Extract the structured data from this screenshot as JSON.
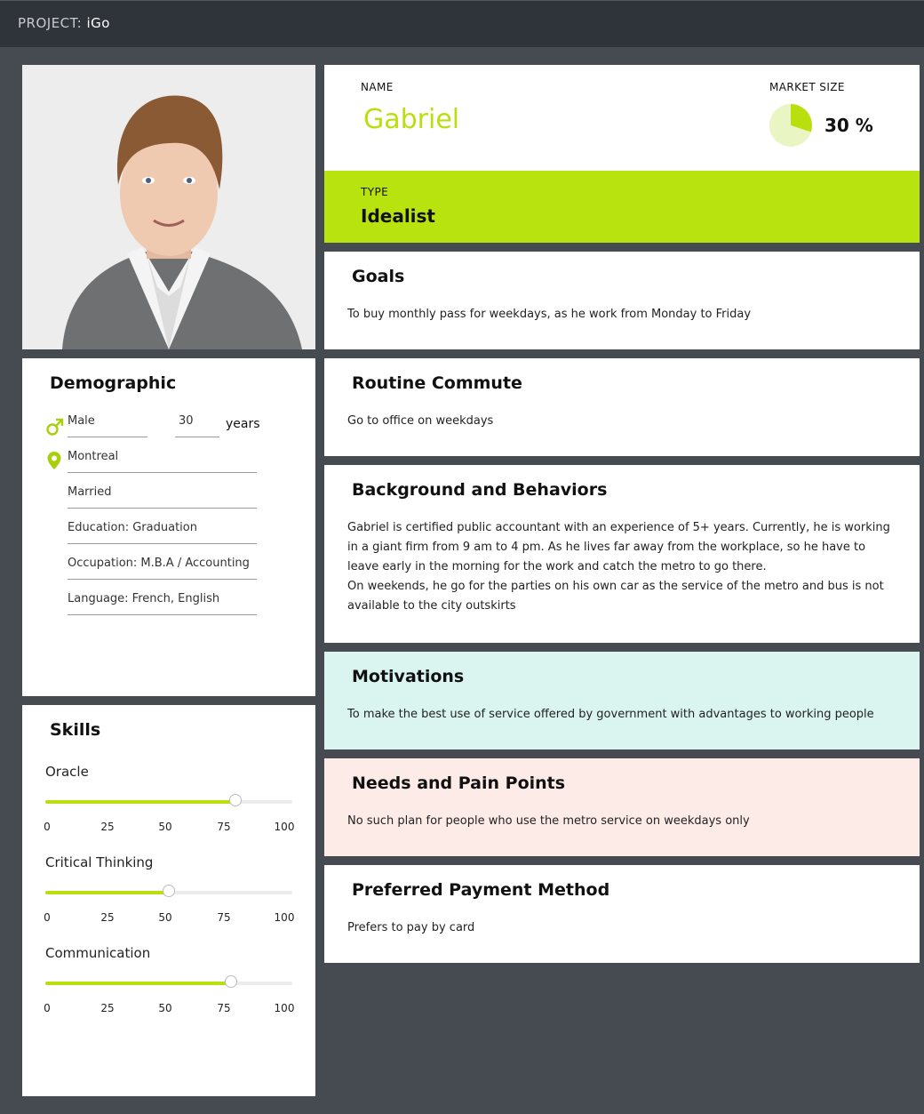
{
  "header": {
    "project_prefix": "PROJECT:",
    "project_name": "iGo"
  },
  "persona": {
    "name_label": "NAME",
    "name": "Gabriel",
    "market_size_label": "MARKET SIZE",
    "market_size": "30 %",
    "market_size_fraction": 0.3,
    "type_label": "TYPE",
    "type": "Idealist"
  },
  "demographic": {
    "title": "Demographic",
    "gender": "Male",
    "age": "30",
    "age_unit": "years",
    "city": "Montreal",
    "marital": "Married",
    "education": "Education: Graduation",
    "occupation": "Occupation: M.B.A / Accounting",
    "language": "Language: French, English"
  },
  "skills": {
    "title": "Skills",
    "ticks": [
      "0",
      "25",
      "50",
      "75",
      "100"
    ],
    "items": [
      {
        "name": "Oracle",
        "value": 77
      },
      {
        "name": "Critical Thinking",
        "value": 50
      },
      {
        "name": "Communication",
        "value": 75
      }
    ]
  },
  "sections": {
    "goals": {
      "title": "Goals",
      "text": "To buy monthly pass for weekdays, as he work from Monday to Friday"
    },
    "routine": {
      "title": "Routine Commute",
      "text": "Go to office on weekdays"
    },
    "background": {
      "title": "Background and Behaviors",
      "text": "Gabriel is certified public accountant with an experience of 5+ years. Currently, he is working in a giant firm from 9 am to 4 pm. As he lives far away from the workplace, so he have to leave early in the morning for the work and catch the metro to go there.\nOn weekends, he go for the parties on his own car as the service of the metro and bus is not available to the city outskirts"
    },
    "motivations": {
      "title": "Motivations",
      "text": "To make the best use of service offered by government with advantages to working people"
    },
    "needs": {
      "title": "Needs and Pain Points",
      "text": "No such plan for people who use the metro service on weekdays only"
    },
    "payment": {
      "title": "Preferred Payment Method",
      "text": "Prefers to pay by card"
    }
  },
  "colors": {
    "accent": "#b9e00e",
    "background": "#464a51",
    "topbar": "#2f333a",
    "motivations_bg": "#daf5ef",
    "needs_bg": "#fdebe8"
  },
  "icons": {
    "gender": "male-symbol-icon",
    "location": "location-pin-icon"
  }
}
